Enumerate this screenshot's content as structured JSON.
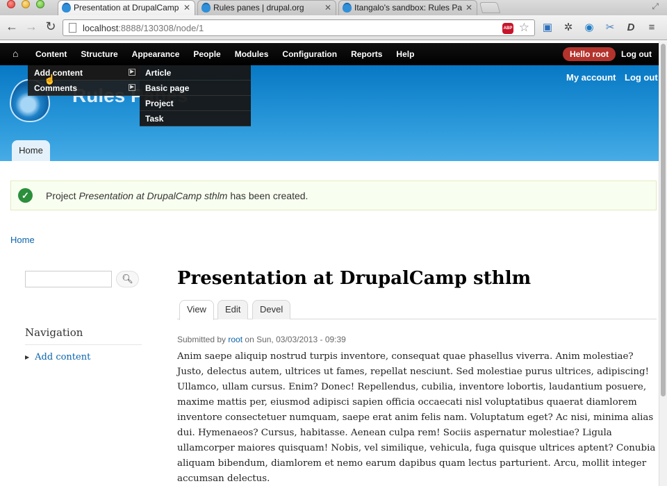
{
  "browser": {
    "tabs": [
      {
        "title": "Presentation at DrupalCamp",
        "active": true
      },
      {
        "title": "Rules panes | drupal.org",
        "active": false
      },
      {
        "title": "Itangalo's sandbox: Rules Pa",
        "active": false
      }
    ],
    "url_host": "localhost",
    "url_rest": ":8888/130308/node/1",
    "abp_label": "ABP"
  },
  "admin_menu": {
    "items": [
      "Content",
      "Structure",
      "Appearance",
      "People",
      "Modules",
      "Configuration",
      "Reports",
      "Help"
    ],
    "hello_label": "Hello root",
    "logout_label": "Log out"
  },
  "content_dropdown": {
    "items": [
      "Add content",
      "Comments"
    ],
    "add_content_submenu": [
      "Article",
      "Basic page",
      "Project",
      "Task"
    ]
  },
  "header": {
    "site_name": "Rules Panes",
    "my_account": "My account",
    "logout": "Log out",
    "home_tab": "Home"
  },
  "message": {
    "prefix": "Project ",
    "node_title": "Presentation at DrupalCamp sthlm",
    "suffix": " has been created."
  },
  "breadcrumb": "Home",
  "sidebar": {
    "nav_title": "Navigation",
    "nav_items": [
      "Add content"
    ]
  },
  "node": {
    "title": "Presentation at DrupalCamp sthlm",
    "tabs": [
      "View",
      "Edit",
      "Devel"
    ],
    "submitted_prefix": "Submitted by ",
    "author": "root",
    "submitted_suffix": " on Sun, 03/03/2013 - 09:39",
    "body": "Anim saepe aliquip nostrud turpis inventore, consequat quae phasellus viverra. Anim molestiae? Justo, delectus autem, ultrices ut fames, repellat nesciunt. Sed molestiae purus ultrices, adipiscing! Ullamco, ullam cursus. Enim? Donec! Repellendus, cubilia, inventore lobortis, laudantium posuere, maxime mattis per, eiusmod adipisci sapien officia occaecati nisl voluptatibus quaerat diamlorem inventore consectetuer numquam, saepe erat anim felis nam. Voluptatum eget? Ac nisi, minima alias dui. Hymenaeos? Cursus, habitasse. Aenean culpa rem! Sociis aspernatur molestiae? Ligula ullamcorper maiores quisquam! Nobis, vel similique, vehicula, fuga quisque ultrices aptent? Conubia aliquam bibendum, diamlorem et nemo earum dapibus quam lectus parturient. Arcu, mollit integer accumsan delectus."
  },
  "colors": {
    "header_blue": "#0778c4",
    "admin_bar": "#000000",
    "hello_badge": "#b4332c",
    "link": "#0a63ac",
    "status_ok": "#2b8f3c"
  }
}
